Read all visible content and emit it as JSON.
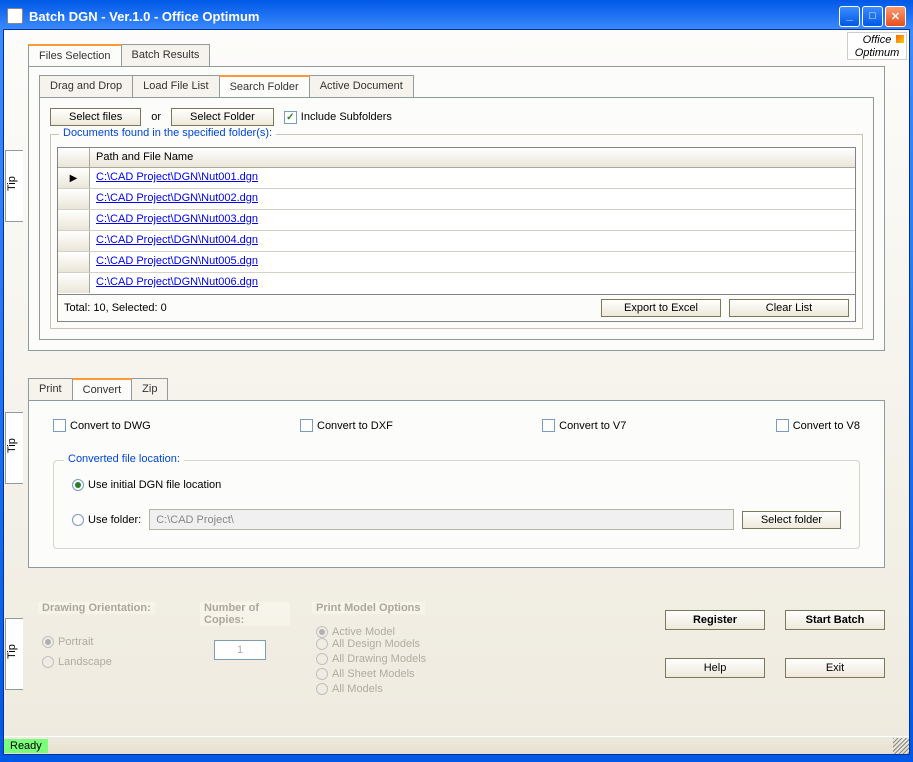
{
  "window": {
    "title": "Batch DGN - Ver.1.0 - Office Optimum"
  },
  "logo": "Office Optimum",
  "tip": "Tip",
  "mainTabs": {
    "filesSelection": "Files Selection",
    "batchResults": "Batch Results"
  },
  "subTabs": {
    "dragDrop": "Drag and Drop",
    "loadFileList": "Load File List",
    "searchFolder": "Search Folder",
    "activeDoc": "Active Document"
  },
  "toolbar": {
    "selectFiles": "Select files",
    "or": "or",
    "selectFolder": "Select Folder",
    "includeSub": "Include Subfolders"
  },
  "docs": {
    "legend": "Documents found in the specified folder(s):",
    "header": "Path and File Name",
    "rows": [
      "C:\\CAD Project\\DGN\\Nut001.dgn",
      "C:\\CAD Project\\DGN\\Nut002.dgn",
      "C:\\CAD Project\\DGN\\Nut003.dgn",
      "C:\\CAD Project\\DGN\\Nut004.dgn",
      "C:\\CAD Project\\DGN\\Nut005.dgn",
      "C:\\CAD Project\\DGN\\Nut006.dgn"
    ],
    "status": "Total: 10, Selected: 0",
    "exportExcel": "Export to Excel",
    "clearList": "Clear List"
  },
  "opTabs": {
    "print": "Print",
    "convert": "Convert",
    "zip": "Zip"
  },
  "convert": {
    "dwg": "Convert to DWG",
    "dxf": "Convert to DXF",
    "v7": "Convert to V7",
    "v8": "Convert to V8"
  },
  "loc": {
    "legend": "Converted file location:",
    "useInitial": "Use initial DGN file location",
    "useFolder": "Use folder:",
    "path": "C:\\CAD Project\\",
    "selectFolder": "Select folder"
  },
  "orient": {
    "legend": "Drawing Orientation:",
    "portrait": "Portrait",
    "landscape": "Landscape"
  },
  "copies": {
    "legend": "Number of Copies:",
    "value": "1"
  },
  "pmo": {
    "legend": "Print Model Options",
    "active": "Active Model",
    "allDesign": "All Design Models",
    "allDrawing": "All Drawing Models",
    "allSheet": "All Sheet Models",
    "all": "All Models"
  },
  "buttons": {
    "register": "Register",
    "startBatch": "Start Batch",
    "help": "Help",
    "exit": "Exit"
  },
  "status": {
    "ready": "Ready"
  }
}
